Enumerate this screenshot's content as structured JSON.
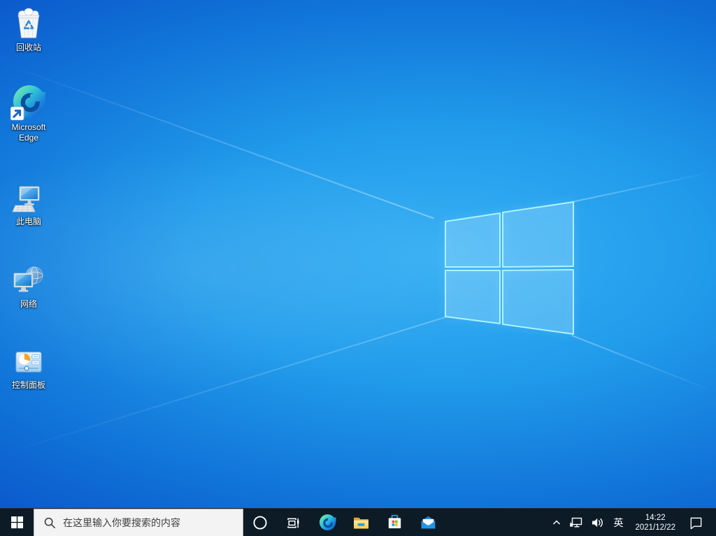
{
  "colors": {
    "wallpaper_center": "#2ba9ee",
    "wallpaper_corner": "#0a47c4",
    "wallpaper_logo_outline": "#aef3ff",
    "taskbar_bg": "#0d1b26",
    "search_box_bg": "#f3f3f3",
    "ms_red": "#f25022",
    "ms_green": "#7fba00",
    "ms_blue": "#00a4ef",
    "ms_yellow": "#ffb900",
    "folder_yellow": "#ffd45e"
  },
  "desktop": {
    "wallpaper_logo_icon": "windows-logo-icon",
    "icons": [
      {
        "id": "recycle-bin",
        "label": "回收站",
        "icon": "recycle-bin-icon"
      },
      {
        "id": "microsoft-edge",
        "label": "Microsoft Edge",
        "icon": "edge-icon"
      },
      {
        "id": "this-pc",
        "label": "此电脑",
        "icon": "computer-icon"
      },
      {
        "id": "network",
        "label": "网络",
        "icon": "network-globe-icon"
      },
      {
        "id": "control-panel",
        "label": "控制面板",
        "icon": "control-panel-icon"
      }
    ]
  },
  "taskbar": {
    "start": {
      "icon": "windows-start-icon"
    },
    "search": {
      "placeholder": "在这里输入你要搜索的内容",
      "icon": "search-icon"
    },
    "apps": [
      {
        "id": "cortana",
        "icon": "cortana-circle-icon"
      },
      {
        "id": "task-view",
        "icon": "task-view-icon"
      },
      {
        "id": "edge",
        "icon": "edge-icon"
      },
      {
        "id": "file-explorer",
        "icon": "folder-icon"
      },
      {
        "id": "microsoft-store",
        "icon": "store-bag-icon"
      },
      {
        "id": "mail",
        "icon": "mail-envelope-icon"
      }
    ],
    "tray": {
      "hidden_icons_icon": "chevron-up-icon",
      "network_icon": "ethernet-icon",
      "volume_icon": "speaker-icon",
      "input_indicator": "英",
      "clock": {
        "time": "14:22",
        "date": "2021/12/22"
      },
      "action_center_icon": "action-center-icon"
    }
  }
}
